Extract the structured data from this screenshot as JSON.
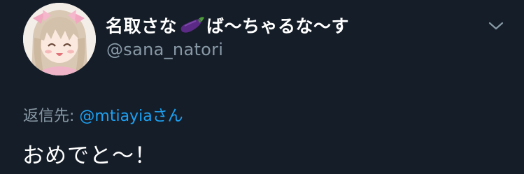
{
  "tweet": {
    "display_name_prefix": "名取さな",
    "display_name_emoji": "eggplant-emoji",
    "display_name_suffix": "ば〜ちゃるな〜す",
    "handle": "@sana_natori",
    "menu_icon": "chevron-down-icon",
    "reply_label": "返信先: ",
    "reply_mention": "@mtiayia",
    "reply_honorific": "さん",
    "text": "おめでと〜！"
  },
  "colors": {
    "background": "#151d28",
    "name": "#ffffff",
    "secondary": "#8899a6",
    "link": "#1da1f2",
    "eggplant": "#5b2a86"
  }
}
